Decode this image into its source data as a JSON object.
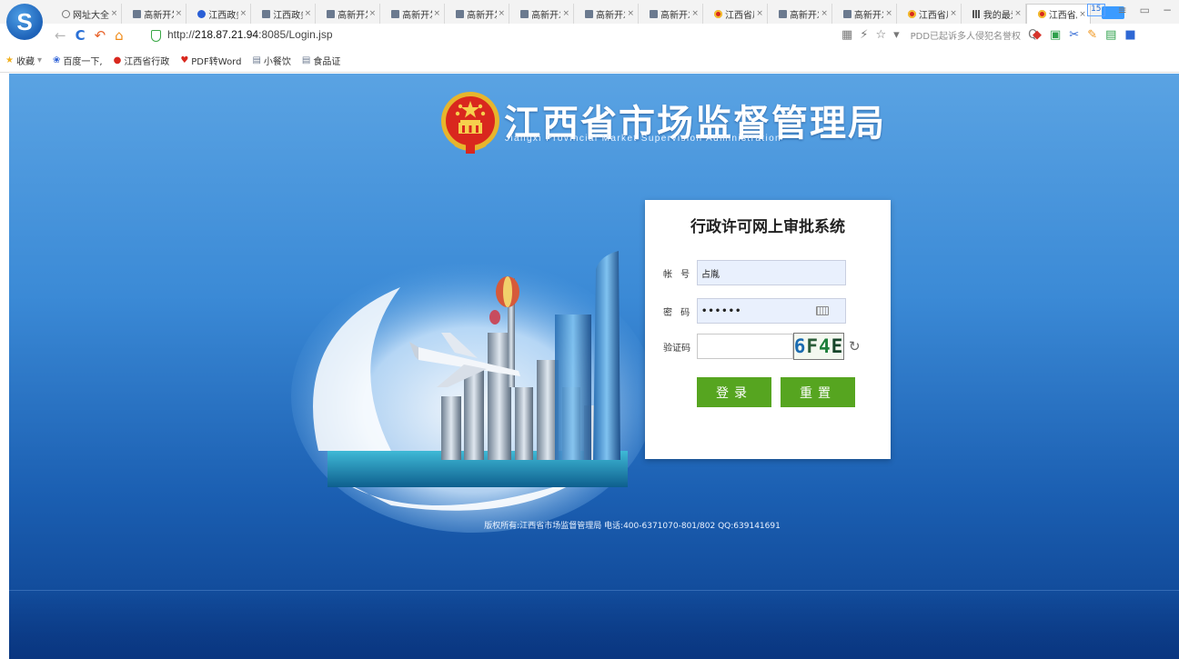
{
  "browser": {
    "logo_letter": "S",
    "tabs": [
      {
        "icon": "globe",
        "title": "网址大全"
      },
      {
        "icon": "page",
        "title": "高新开发"
      },
      {
        "icon": "paw",
        "title": "江西政务"
      },
      {
        "icon": "page",
        "title": "江西政务"
      },
      {
        "icon": "page",
        "title": "高新开发"
      },
      {
        "icon": "page",
        "title": "高新开发"
      },
      {
        "icon": "page",
        "title": "高新开发"
      },
      {
        "icon": "page",
        "title": "高新开发"
      },
      {
        "icon": "page",
        "title": "高新开发"
      },
      {
        "icon": "page",
        "title": "高新开发"
      },
      {
        "icon": "emblem",
        "title": "江西省局"
      },
      {
        "icon": "page",
        "title": "高新开发"
      },
      {
        "icon": "page",
        "title": "高新开发"
      },
      {
        "icon": "emblem",
        "title": "江西省局"
      },
      {
        "icon": "grid",
        "title": "我的最爱"
      },
      {
        "icon": "emblem",
        "title": "江西省局",
        "active": true
      }
    ],
    "tab_close_glyph": "×",
    "tab_count": "15",
    "nav": {
      "back": "←",
      "reload": "C",
      "undo": "↶",
      "home": "⌂"
    },
    "url_prefix": "http://",
    "url_host": "218.87.21.94",
    "url_path": ":8085/Login.jsp",
    "addr_right": {
      "qr": "▦",
      "bolt": "⚡",
      "star": "☆",
      "dropdown": "▾",
      "promo": "PDD已起诉多人侵犯名誉权",
      "search": "Q"
    },
    "bookmarks": [
      {
        "icon": "star",
        "label": "收藏"
      },
      {
        "icon": "paw",
        "label": "百度一下,"
      },
      {
        "icon": "emblem",
        "label": "江西省行政"
      },
      {
        "icon": "heart",
        "label": "PDF转Word"
      },
      {
        "icon": "page",
        "label": "小餐饮"
      },
      {
        "icon": "page",
        "label": "食品证"
      }
    ],
    "bookmarks_dropdown": "▾"
  },
  "page": {
    "title": "江西省市场监督管理局",
    "subtitle": "Jiangxi Provincial Market Supervision Administration",
    "login": {
      "heading": "行政许可网上审批系统",
      "account_label": "帐 号",
      "account_value": "占胤",
      "password_label": "密 码",
      "password_value": "••••••",
      "captcha_label": "验证码",
      "captcha_chars": [
        "6",
        "F",
        "4",
        "E"
      ],
      "refresh_glyph": "↻",
      "login_button": "登录",
      "reset_button": "重置"
    },
    "footer": "版权所有:江西省市场监督管理局 电话:400-6371070-801/802 QQ:639141691"
  },
  "colors": {
    "button_green": "#56a520",
    "bg_blue_top": "#5aa3e3",
    "bg_blue_bottom": "#0c3f8c",
    "input_fill": "#e9f0fd"
  }
}
